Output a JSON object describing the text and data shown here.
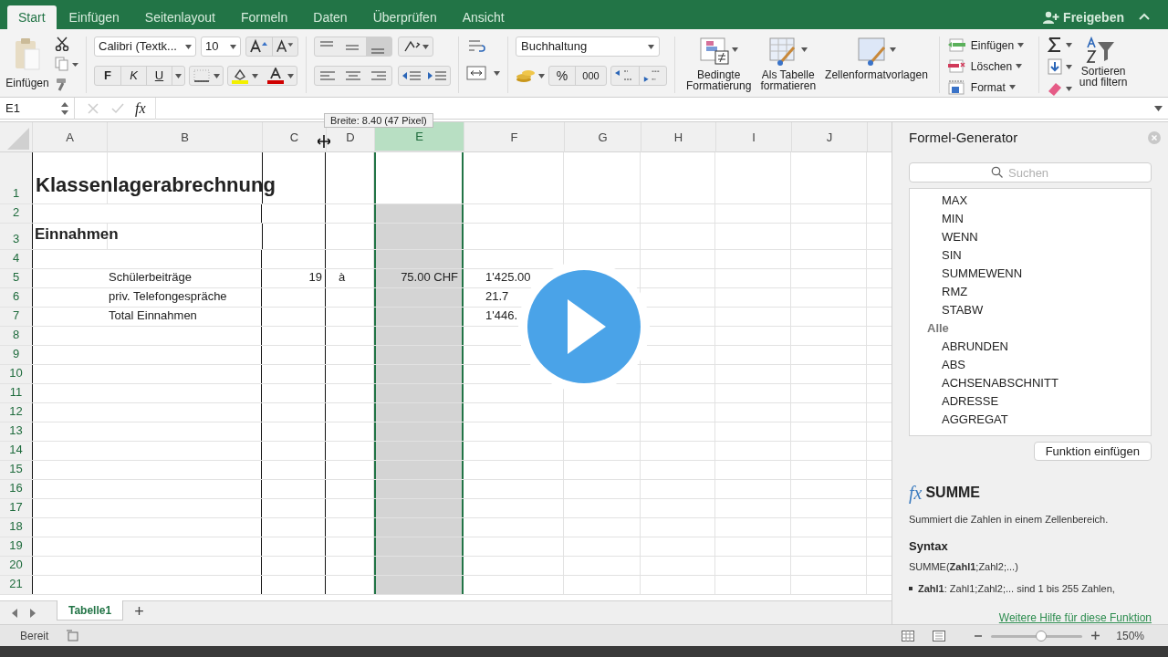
{
  "ribbon_tabs": [
    {
      "label": "Start",
      "selected": true
    },
    {
      "label": "Einfügen",
      "selected": false
    },
    {
      "label": "Seitenlayout",
      "selected": false
    },
    {
      "label": "Formeln",
      "selected": false
    },
    {
      "label": "Daten",
      "selected": false
    },
    {
      "label": "Überprüfen",
      "selected": false
    },
    {
      "label": "Ansicht",
      "selected": false
    }
  ],
  "share_button": "Freigeben",
  "ribbon": {
    "paste_label": "Einfügen",
    "font_name": "Calibri (Textk...",
    "font_size": "10",
    "bold": "F",
    "italic": "K",
    "underline": "U",
    "vertical_align": [
      {
        "kind": "top",
        "selected": false
      },
      {
        "kind": "middle",
        "selected": false
      },
      {
        "kind": "bottom",
        "selected": true
      }
    ],
    "number_format": "Buchhaltung",
    "percent": "%",
    "thousands": "000",
    "style_buttons": [
      {
        "kind": "conditional",
        "label": "Bedingte\nFormatierung"
      },
      {
        "kind": "table",
        "label": "Als Tabelle\nformatieren"
      },
      {
        "kind": "styles",
        "label": "Zellenformatvorlagen"
      }
    ],
    "cell_buttons": [
      {
        "kind": "insert",
        "label": "Einfügen"
      },
      {
        "kind": "delete",
        "label": "Löschen"
      },
      {
        "kind": "format",
        "label": "Format"
      }
    ],
    "sort_label": "Sortieren\nund filtern"
  },
  "formula_bar": {
    "name_box": "E1",
    "fx": "fx"
  },
  "tooltip": "Breite: 8.40 (47 Pixel)",
  "sheet": {
    "columns": [
      {
        "label": "A",
        "selected": false
      },
      {
        "label": "B",
        "selected": false
      },
      {
        "label": "C",
        "selected": false
      },
      {
        "label": "D",
        "selected": false
      },
      {
        "label": "E",
        "selected": true
      },
      {
        "label": "F",
        "selected": false
      },
      {
        "label": "G",
        "selected": false
      },
      {
        "label": "H",
        "selected": false
      },
      {
        "label": "I",
        "selected": false
      },
      {
        "label": "J",
        "selected": false
      }
    ],
    "rows": [
      {
        "label": "1",
        "kind": "title",
        "cells": {
          "a": "Klassenlagerabrechnung"
        }
      },
      {
        "label": "2",
        "kind": "normal",
        "cells": {}
      },
      {
        "label": "3",
        "kind": "heading",
        "cells": {
          "a": "Einnahmen"
        }
      },
      {
        "label": "4",
        "kind": "normal",
        "cells": {}
      },
      {
        "label": "5",
        "kind": "normal",
        "cells": {
          "b": "Schülerbeiträge",
          "c": "19",
          "d": "à",
          "e": "75.00 CHF",
          "f": "1'425.00"
        }
      },
      {
        "label": "6",
        "kind": "normal",
        "cells": {
          "b": "priv. Telefongespräche",
          "f": "21.7"
        }
      },
      {
        "label": "7",
        "kind": "normal",
        "cells": {
          "b": "Total Einnahmen",
          "f": "1'446."
        }
      },
      {
        "label": "8",
        "kind": "normal",
        "cells": {}
      },
      {
        "label": "9",
        "kind": "normal",
        "cells": {}
      },
      {
        "label": "10",
        "kind": "normal",
        "cells": {}
      },
      {
        "label": "11",
        "kind": "normal",
        "cells": {}
      },
      {
        "label": "12",
        "kind": "normal",
        "cells": {}
      },
      {
        "label": "13",
        "kind": "normal",
        "cells": {}
      },
      {
        "label": "14",
        "kind": "normal",
        "cells": {}
      },
      {
        "label": "15",
        "kind": "normal",
        "cells": {}
      },
      {
        "label": "16",
        "kind": "normal",
        "cells": {}
      },
      {
        "label": "17",
        "kind": "normal",
        "cells": {}
      },
      {
        "label": "18",
        "kind": "normal",
        "cells": {}
      },
      {
        "label": "19",
        "kind": "normal",
        "cells": {}
      },
      {
        "label": "20",
        "kind": "normal",
        "cells": {}
      },
      {
        "label": "21",
        "kind": "normal",
        "cells": {}
      }
    ]
  },
  "formula_builder": {
    "title": "Formel-Generator",
    "search": {
      "placeholder": "Suchen"
    },
    "functions": [
      {
        "label": "MAX",
        "kind": "function"
      },
      {
        "label": "MIN",
        "kind": "function"
      },
      {
        "label": "WENN",
        "kind": "function"
      },
      {
        "label": "SIN",
        "kind": "function"
      },
      {
        "label": "SUMMEWENN",
        "kind": "function"
      },
      {
        "label": "RMZ",
        "kind": "function"
      },
      {
        "label": "STABW",
        "kind": "function"
      },
      {
        "label": "Alle",
        "kind": "category"
      },
      {
        "label": "ABRUNDEN",
        "kind": "function"
      },
      {
        "label": "ABS",
        "kind": "function"
      },
      {
        "label": "ACHSENABSCHNITT",
        "kind": "function"
      },
      {
        "label": "ADRESSE",
        "kind": "function"
      },
      {
        "label": "AGGREGAT",
        "kind": "function"
      }
    ],
    "insert_button": "Funktion einfügen",
    "fx": "fx",
    "function_name": "SUMME",
    "description": "Summiert die Zahlen in einem Zellenbereich.",
    "syntax_heading": "Syntax",
    "syntax": "SUMME(**Zahl1**;Zahl2;...)",
    "arguments": [
      "**Zahl1**: Zahl1;Zahl2;... sind 1 bis 255 Zahlen,"
    ],
    "help_link": "Weitere Hilfe für diese Funktion"
  },
  "sheet_tabs": [
    {
      "label": "Tabelle1",
      "selected": true
    }
  ],
  "add_sheet": "+",
  "status_bar": {
    "status": "Bereit",
    "zoom": "150%",
    "zoom_slider": {
      "level": 0.55
    }
  }
}
